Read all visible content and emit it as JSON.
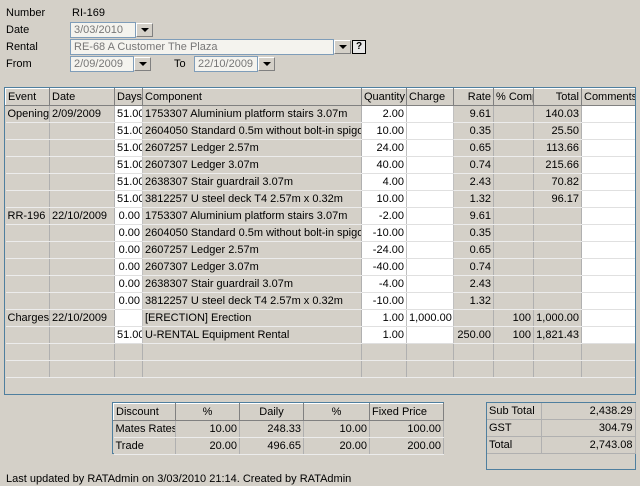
{
  "header": {
    "number_label": "Number",
    "number_value": "RI-169",
    "date_label": "Date",
    "date_value": "3/03/2010",
    "rental_label": "Rental",
    "rental_value": "RE-68 A Customer The Plaza",
    "help_label": "?",
    "from_label": "From",
    "from_value": "2/09/2009",
    "to_label": "To",
    "to_value": "22/10/2009"
  },
  "grid": {
    "columns": [
      "Event",
      "Date",
      "Days",
      "Component",
      "Quantity",
      "Charge",
      "Rate",
      "% Comp",
      "Total",
      "Comments"
    ],
    "rows": [
      [
        "Opening",
        "2/09/2009",
        "51.00",
        "1753307 Aluminium platform stairs 3.07m",
        "2.00",
        "",
        "9.61",
        "",
        "140.03",
        ""
      ],
      [
        "",
        "",
        "51.00",
        "2604050 Standard 0.5m without bolt-in spigot",
        "10.00",
        "",
        "0.35",
        "",
        "25.50",
        ""
      ],
      [
        "",
        "",
        "51.00",
        "2607257 Ledger 2.57m",
        "24.00",
        "",
        "0.65",
        "",
        "113.66",
        ""
      ],
      [
        "",
        "",
        "51.00",
        "2607307 Ledger 3.07m",
        "40.00",
        "",
        "0.74",
        "",
        "215.66",
        ""
      ],
      [
        "",
        "",
        "51.00",
        "2638307 Stair guardrail 3.07m",
        "4.00",
        "",
        "2.43",
        "",
        "70.82",
        ""
      ],
      [
        "",
        "",
        "51.00",
        "3812257 U steel deck T4 2.57m x 0.32m",
        "10.00",
        "",
        "1.32",
        "",
        "96.17",
        ""
      ],
      [
        "RR-196",
        "22/10/2009",
        "0.00",
        "1753307 Aluminium platform stairs 3.07m",
        "-2.00",
        "",
        "9.61",
        "",
        "",
        ""
      ],
      [
        "",
        "",
        "0.00",
        "2604050 Standard 0.5m without bolt-in spigot",
        "-10.00",
        "",
        "0.35",
        "",
        "",
        ""
      ],
      [
        "",
        "",
        "0.00",
        "2607257 Ledger 2.57m",
        "-24.00",
        "",
        "0.65",
        "",
        "",
        ""
      ],
      [
        "",
        "",
        "0.00",
        "2607307 Ledger 3.07m",
        "-40.00",
        "",
        "0.74",
        "",
        "",
        ""
      ],
      [
        "",
        "",
        "0.00",
        "2638307 Stair guardrail 3.07m",
        "-4.00",
        "",
        "2.43",
        "",
        "",
        ""
      ],
      [
        "",
        "",
        "0.00",
        "3812257 U steel deck T4 2.57m x 0.32m",
        "-10.00",
        "",
        "1.32",
        "",
        "",
        ""
      ],
      [
        "Charges",
        "22/10/2009",
        "",
        "[ERECTION] Erection",
        "1.00",
        "1,000.00",
        "",
        "100",
        "1,000.00",
        ""
      ],
      [
        "",
        "",
        "51.00",
        "U-RENTAL Equipment Rental",
        "1.00",
        "",
        "250.00",
        "100",
        "1,821.43",
        ""
      ]
    ]
  },
  "discount": {
    "columns": [
      "Discount",
      "%",
      "Daily",
      "%",
      "Fixed Price"
    ],
    "rows": [
      [
        "Mates Rates",
        "10.00",
        "248.33",
        "10.00",
        "100.00"
      ],
      [
        "Trade",
        "20.00",
        "496.65",
        "20.00",
        "200.00"
      ]
    ]
  },
  "totals": {
    "rows": [
      [
        "Sub Total",
        "2,438.29"
      ],
      [
        "GST",
        "304.79"
      ],
      [
        "Total",
        "2,743.08"
      ]
    ]
  },
  "footer": {
    "status": "Last updated by RATAdmin on 3/03/2010 21:14. Created by RATAdmin"
  }
}
